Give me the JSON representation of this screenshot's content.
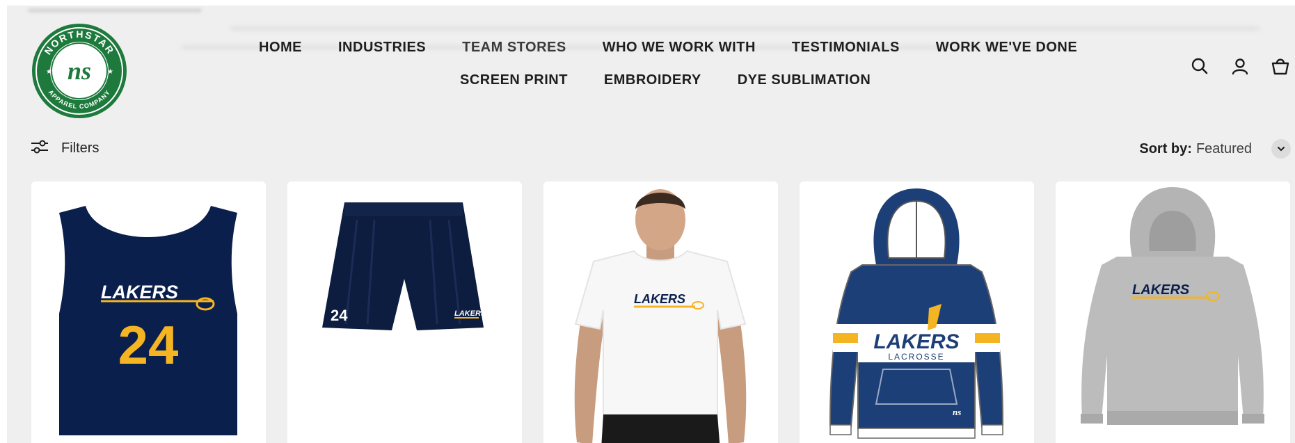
{
  "brand": {
    "ring_top": "NORTHSTAR",
    "ring_bottom": "APPAREL COMPANY",
    "monogram": "ns",
    "color": "#1e7a3c"
  },
  "nav": {
    "row1": [
      "HOME",
      "INDUSTRIES",
      "TEAM STORES",
      "WHO WE WORK WITH",
      "TESTIMONIALS",
      "WORK WE'VE DONE"
    ],
    "row2": [
      "SCREEN PRINT",
      "EMBROIDERY",
      "DYE SUBLIMATION"
    ]
  },
  "header_icons": [
    "search-icon",
    "account-icon",
    "cart-icon"
  ],
  "toolbar": {
    "filters_label": "Filters",
    "sort_label": "Sort by:",
    "sort_value": "Featured"
  },
  "products": [
    {
      "type": "reversible-pinnie",
      "logo_text": "LAKERS",
      "number": "24",
      "color": "#0b1f4d"
    },
    {
      "type": "mesh-shorts",
      "logo_text": "LAKERS",
      "number": "24",
      "color": "#0d1d3f"
    },
    {
      "type": "white-tee-model",
      "logo_text": "LAKERS",
      "color": "#ffffff"
    },
    {
      "type": "striped-hoodie",
      "logo_text": "LAKERS",
      "sub_text": "LACROSSE",
      "badge": "ns",
      "color": "#1d3f77"
    },
    {
      "type": "grey-hoodie",
      "logo_text": "LAKERS",
      "color": "#b9b9b9"
    }
  ],
  "colors": {
    "navy": "#0b1f4d",
    "gold": "#f5b523",
    "background": "#efefef"
  }
}
